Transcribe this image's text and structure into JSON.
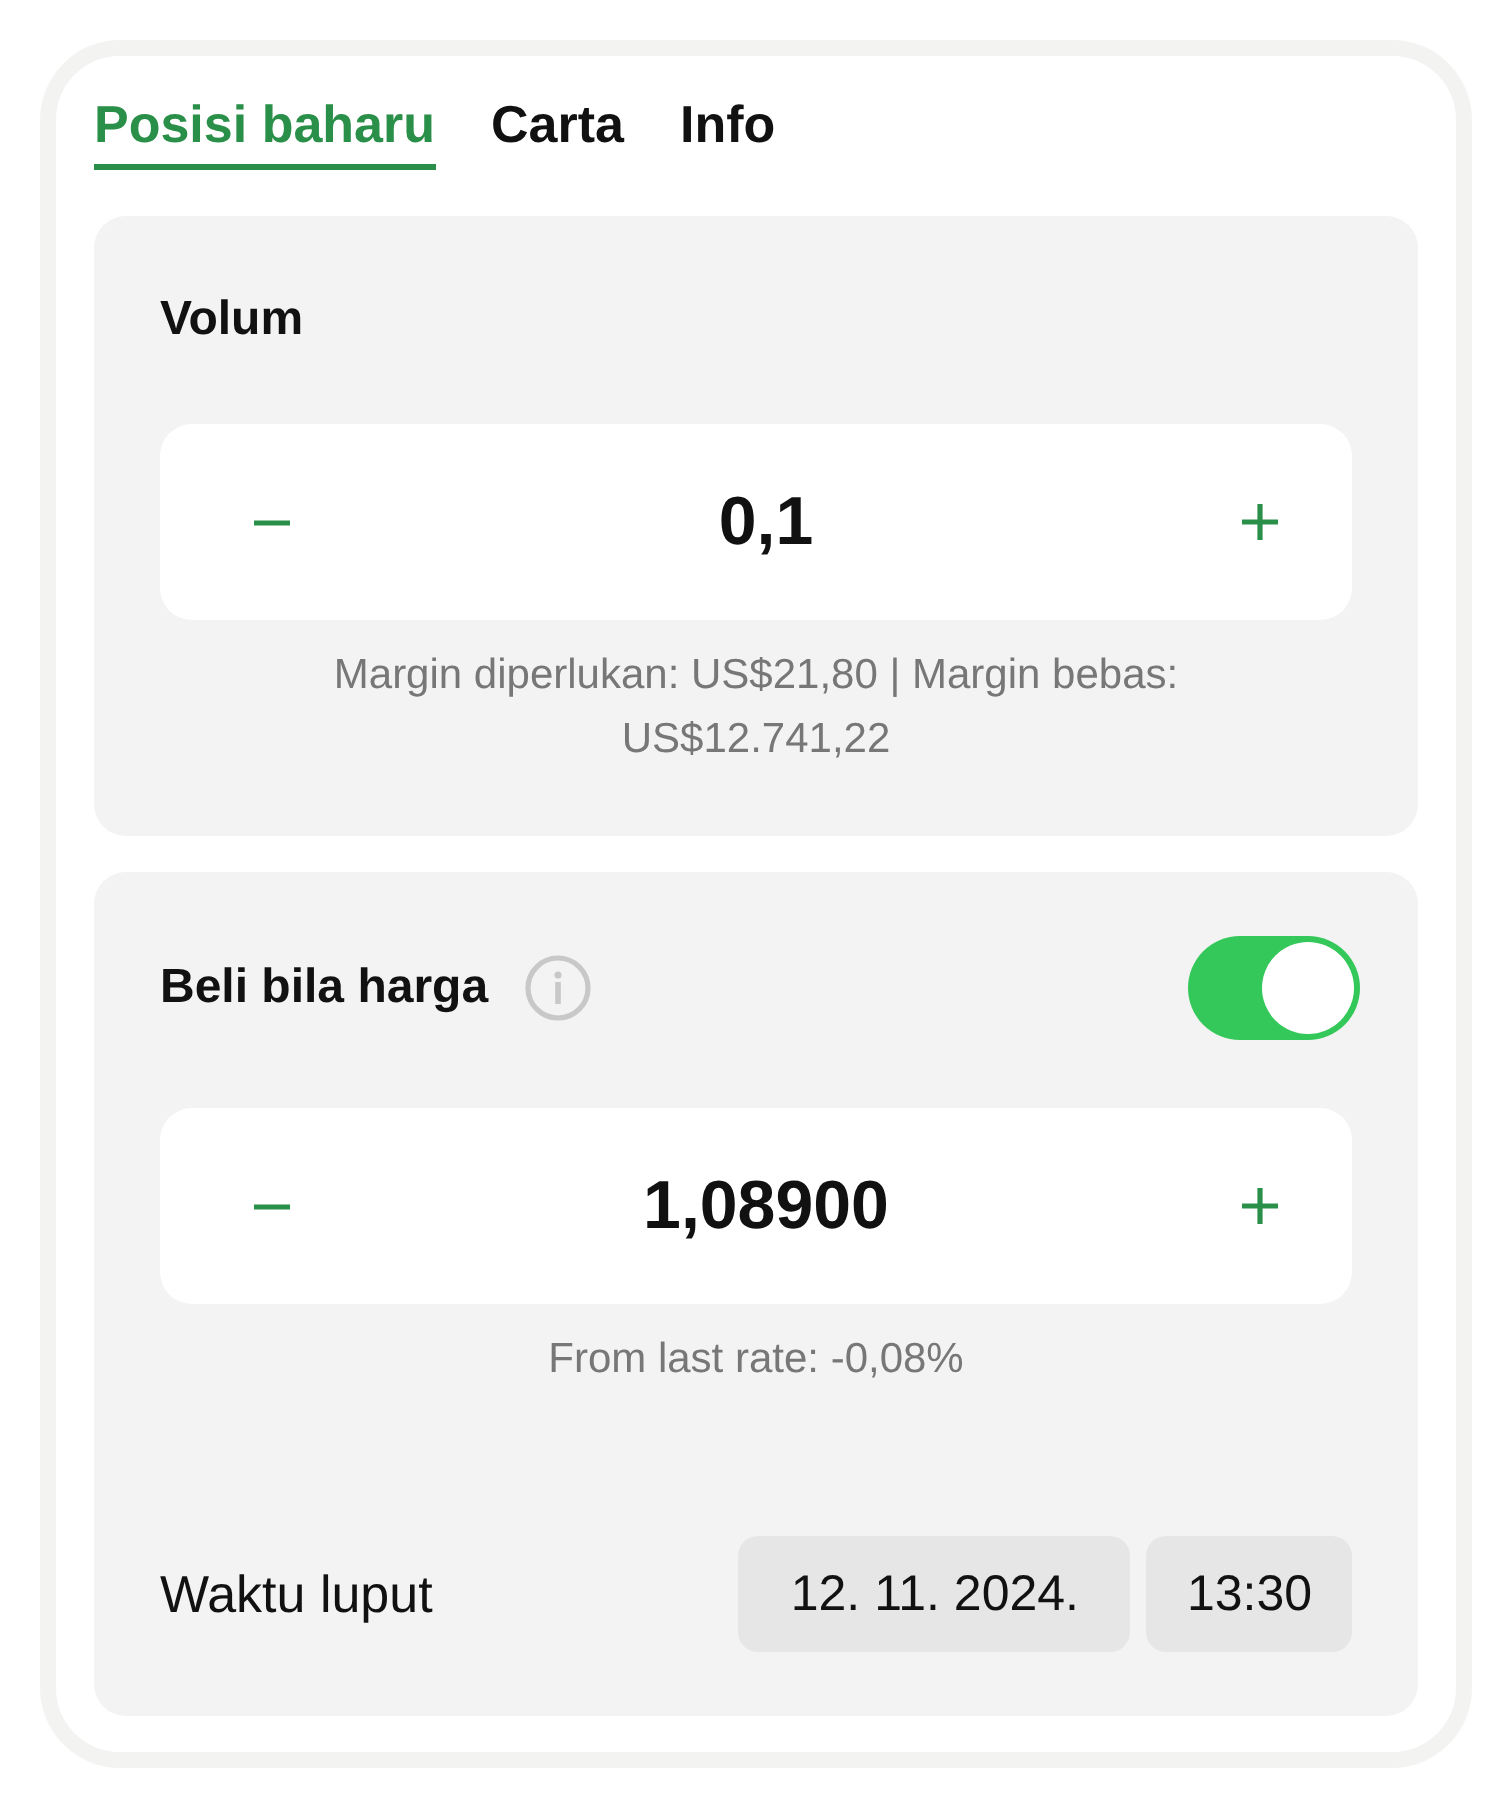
{
  "tabs": [
    {
      "label": "Posisi baharu",
      "selected": true
    },
    {
      "label": "Carta",
      "selected": false
    },
    {
      "label": "Info",
      "selected": false
    }
  ],
  "volume": {
    "title": "Volum",
    "value": "0,1",
    "note": "Margin diperlukan: US$21,80 | Margin bebas: US$12.741,22"
  },
  "limit": {
    "title": "Beli bila harga",
    "on": true,
    "value": "1,08900",
    "note": "From last rate: -0,08%"
  },
  "expiry": {
    "label": "Waktu luput",
    "date": "12. 11. 2024.",
    "time": "13:30"
  }
}
